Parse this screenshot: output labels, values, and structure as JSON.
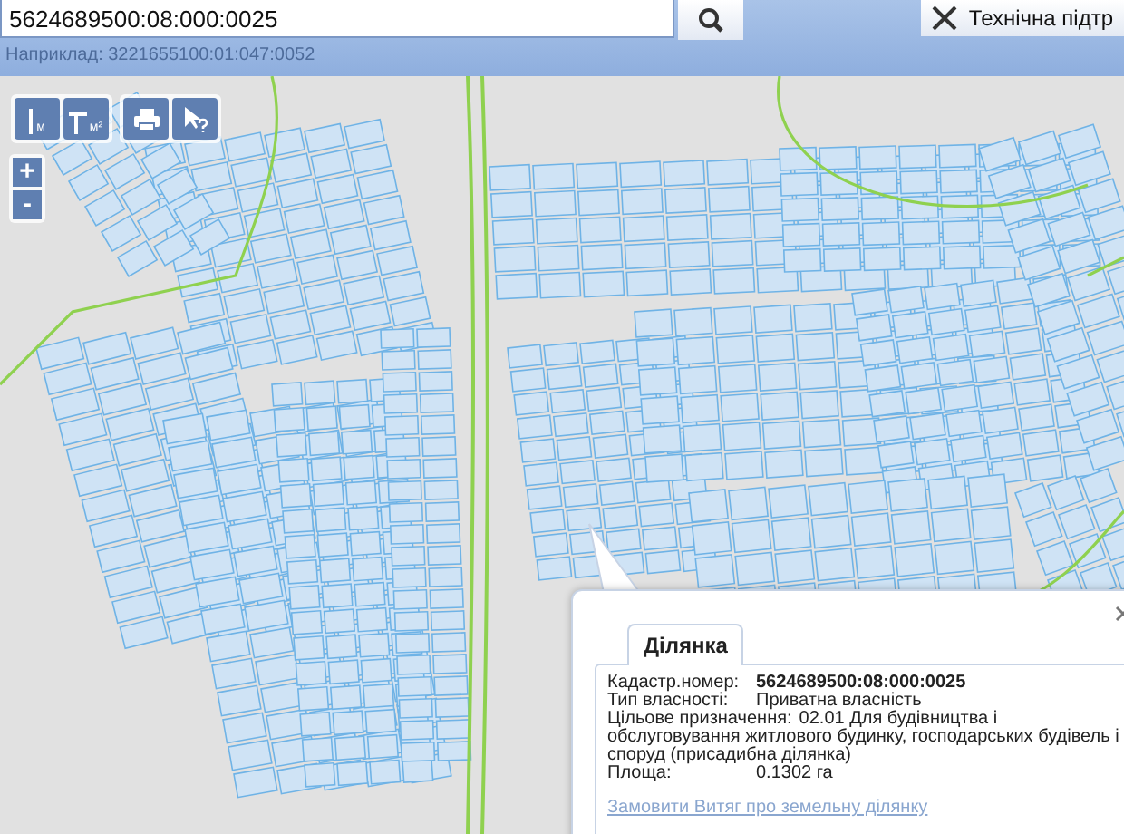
{
  "search": {
    "value": "5624689500:08:000:0025",
    "hint": "Наприклад: 3221655100:01:047:0052"
  },
  "help_button": {
    "label": "Технічна підтр"
  },
  "map_tools": [
    {
      "kind": "ruler",
      "unit": "м"
    },
    {
      "kind": "area",
      "unit": "м²"
    },
    {
      "kind": "print"
    },
    {
      "kind": "info"
    }
  ],
  "zoom": [
    "+",
    "-"
  ],
  "popup": {
    "tabs": [
      {
        "label": "Ділянка",
        "selected": true
      }
    ],
    "fields": [
      {
        "label": "Кадастр.номер:",
        "value": "5624689500:08:000:0025",
        "bold": true
      },
      {
        "label": "Тип власності:",
        "value": "Приватна власність",
        "bold": false
      },
      {
        "label": "Цільове призначення:",
        "value": "02.01 Для будівництва і обслуговування житлового будинку, господарських будівель і споруд (присадибна ділянка)",
        "bold": false
      },
      {
        "label": "Площа:",
        "value": "0.1302 га",
        "bold": false
      }
    ],
    "links": [
      "Замовити Витяг про земельну ділянку"
    ]
  }
}
